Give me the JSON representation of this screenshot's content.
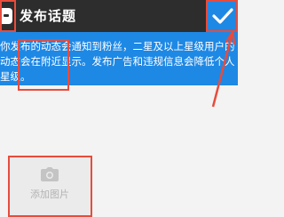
{
  "header": {
    "title": "发布话题",
    "confirm_icon": "checkmark-icon",
    "app_icon": "chat-bubble-icon"
  },
  "notice": {
    "text": "你发布的动态会通知到粉丝，二星及以上星级用户的动态会在附近显示。发布广告和违规信息会降低个人星级。"
  },
  "photo": {
    "label": "添加图片",
    "icon": "camera-icon"
  },
  "colors": {
    "topbar": "#2d2d2d",
    "accent": "#1e88e5",
    "annotation": "#e74c3c",
    "background": "#f3f3f3"
  }
}
